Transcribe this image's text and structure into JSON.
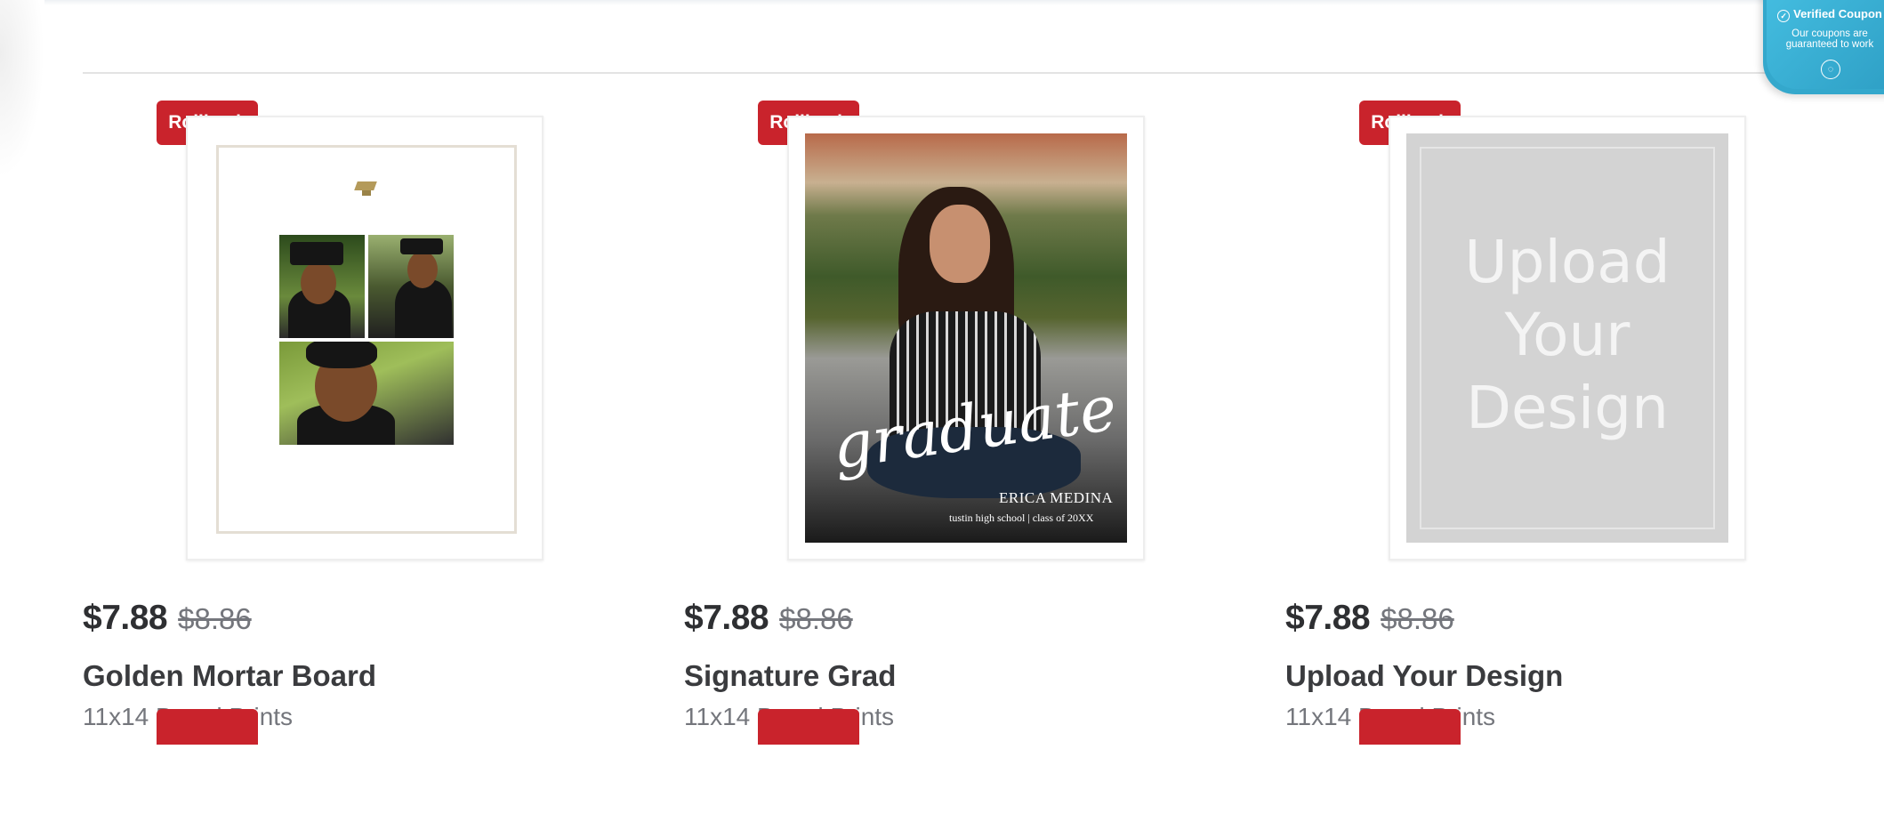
{
  "coupon_widget": {
    "check_glyph": "✓",
    "title": "Verified Coupon",
    "subtitle_line1": "Our coupons are",
    "subtitle_line2": "guaranteed to work",
    "icon_glyph": "◌"
  },
  "products": [
    {
      "badge": "Rollback",
      "price": "$7.88",
      "was_price": "$8.86",
      "title": "Golden Mortar Board",
      "subtitle": "11x14 Board Prints"
    },
    {
      "badge": "Rollback",
      "price": "$7.88",
      "was_price": "$8.86",
      "title": "Signature Grad",
      "subtitle": "11x14 Board Prints",
      "art": {
        "script": "graduate",
        "name": "ERICA MEDINA",
        "school": "tustin high school | class of 20XX"
      }
    },
    {
      "badge": "Rollback",
      "price": "$7.88",
      "was_price": "$8.86",
      "title": "Upload Your Design",
      "subtitle": "11x14 Board Prints",
      "art": {
        "line1": "Upload",
        "line2": "Your",
        "line3": "Design"
      }
    }
  ],
  "colors": {
    "rollback_red": "#c9232c",
    "coupon_blue": "#34a8cc",
    "price_text": "#2e2f32",
    "muted_text": "#74767c"
  }
}
